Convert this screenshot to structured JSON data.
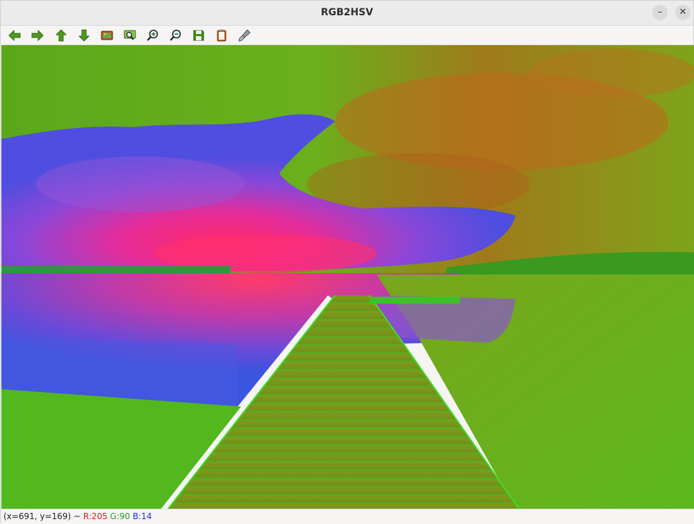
{
  "window": {
    "title": "RGB2HSV",
    "minimize_label": "–",
    "close_label": "✕"
  },
  "toolbar": {
    "buttons": [
      {
        "name": "pan-left",
        "icon": "arrow-left-icon"
      },
      {
        "name": "pan-right",
        "icon": "arrow-right-icon"
      },
      {
        "name": "pan-up",
        "icon": "arrow-up-icon"
      },
      {
        "name": "pan-down",
        "icon": "arrow-down-icon"
      },
      {
        "name": "zoom-image",
        "icon": "image-icon"
      },
      {
        "name": "zoom-region",
        "icon": "zoom-region-icon"
      },
      {
        "name": "zoom-in",
        "icon": "zoom-in-icon"
      },
      {
        "name": "zoom-out",
        "icon": "zoom-out-icon"
      },
      {
        "name": "save",
        "icon": "save-icon"
      },
      {
        "name": "copy",
        "icon": "clipboard-icon"
      },
      {
        "name": "properties",
        "icon": "brush-icon"
      }
    ]
  },
  "status": {
    "coords": "(x=691, y=169) ~ ",
    "r": "R:205",
    "g": "G:90",
    "b": "B:14"
  },
  "colors": {
    "accent_green": "#4a9a1e",
    "status_red": "#e01b1b",
    "status_green": "#2a9a2a",
    "status_blue": "#1a33d6"
  }
}
